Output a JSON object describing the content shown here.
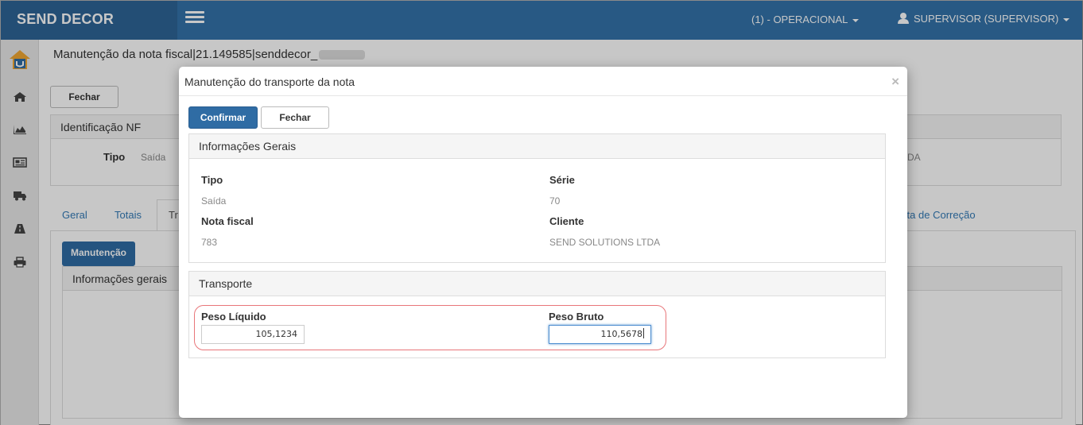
{
  "app": {
    "brand": "SEND DECOR",
    "profile": "(1) - OPERACIONAL",
    "user": "SUPERVISOR (SUPERVISOR)"
  },
  "sidebar": {
    "icons": [
      "home-icon",
      "area-chart-icon",
      "newspaper-icon",
      "truck-icon",
      "road-icon",
      "print-icon"
    ]
  },
  "page": {
    "title": "Manutenção da nota fiscal|21.149585|senddecor_",
    "close_label": "Fechar",
    "ident_header": "Identificação NF",
    "tipo_label": "Tipo",
    "tipo_value": "Saída",
    "cliente_partial": "DA",
    "tabs": [
      "Geral",
      "Totais",
      "Tr",
      "arta de Correção"
    ],
    "maintenance_label": "Manutenção",
    "info_gerais_header": "Informações gerais"
  },
  "modal": {
    "title": "Manutenção do transporte da nota",
    "close_symbol": "×",
    "confirm_label": "Confirmar",
    "close_label": "Fechar",
    "general": {
      "header": "Informações Gerais",
      "tipo_label": "Tipo",
      "tipo_value": "Saída",
      "serie_label": "Série",
      "serie_value": "70",
      "nota_label": "Nota fiscal",
      "nota_value": "783",
      "cliente_label": "Cliente",
      "cliente_value": "SEND SOLUTIONS LTDA"
    },
    "transport": {
      "header": "Transporte",
      "peso_liquido_label": "Peso Líquido",
      "peso_liquido_value": "105,1234",
      "peso_bruto_label": "Peso Bruto",
      "peso_bruto_value": "110,5678"
    }
  },
  "colors": {
    "navbar": "#3472a9",
    "brand_bg": "#2d6497",
    "primary_button": "#2f6ca4",
    "highlight_border": "#e8767a"
  }
}
